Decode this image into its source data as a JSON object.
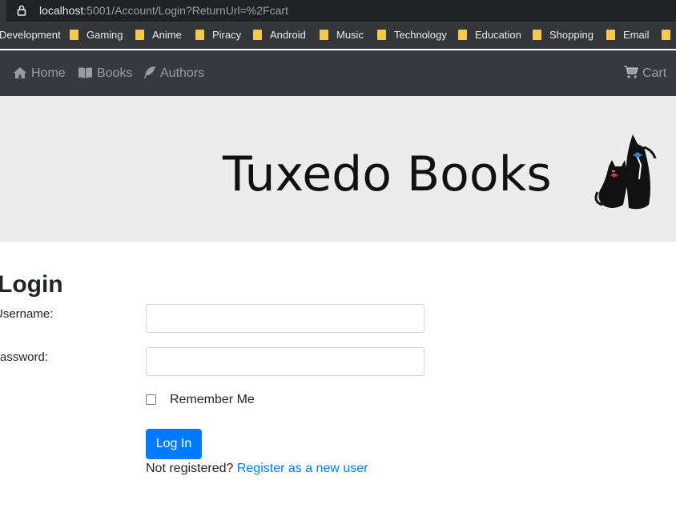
{
  "browser": {
    "url_host": "localhost",
    "url_rest": ":5001/Account/Login?ReturnUrl=%2Fcart",
    "bookmarks": [
      "Development",
      "Gaming",
      "Anime",
      "Piracy",
      "Android",
      "Music",
      "Technology",
      "Education",
      "Shopping",
      "Email"
    ]
  },
  "navbar": {
    "home": "Home",
    "books": "Books",
    "authors": "Authors",
    "cart": "Cart"
  },
  "banner": {
    "brand": "Tuxedo Books"
  },
  "login": {
    "title": "Login",
    "username_label": "Username:",
    "password_label": "Password:",
    "username_value": "",
    "password_value": "",
    "remember_label": "Remember Me",
    "remember_checked": false,
    "submit_label": "Log In",
    "not_registered": "Not registered?",
    "register_link": "Register as a new user"
  },
  "colors": {
    "navbar_bg": "#343a40",
    "banner_bg": "#ececec",
    "primary": "#007bff",
    "bookmark_folder": "#f6c84e"
  }
}
